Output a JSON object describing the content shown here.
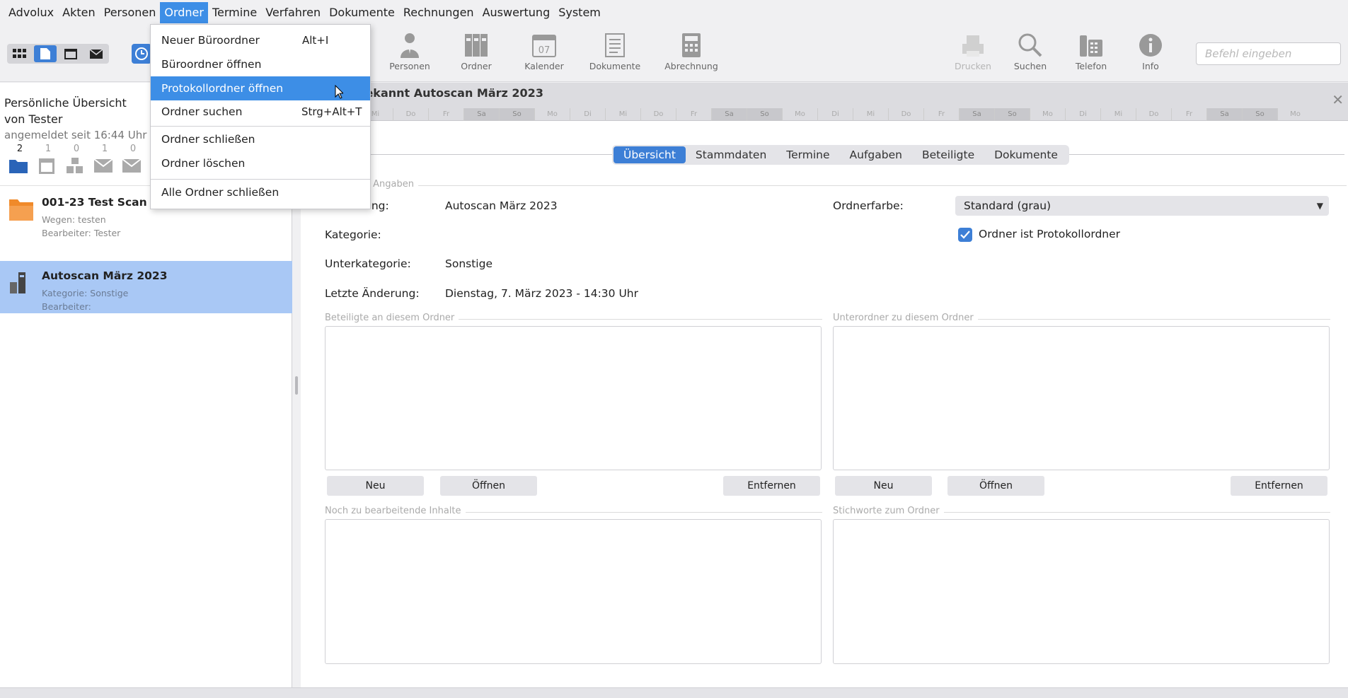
{
  "menubar": {
    "items": [
      "Advolux",
      "Akten",
      "Personen",
      "Ordner",
      "Termine",
      "Verfahren",
      "Dokumente",
      "Rechnungen",
      "Auswertung",
      "System"
    ]
  },
  "ordner_menu": {
    "items": [
      {
        "label": "Neuer Büroordner",
        "shortcut": "Alt+I"
      },
      {
        "label": "Büroordner öffnen",
        "shortcut": ""
      },
      {
        "label": "Protokollordner öffnen",
        "shortcut": ""
      },
      {
        "label": "Ordner suchen",
        "shortcut": "Strg+Alt+T"
      },
      {
        "label": "Ordner schließen",
        "shortcut": ""
      },
      {
        "label": "Ordner löschen",
        "shortcut": ""
      },
      {
        "label": "Alle Ordner schließen",
        "shortcut": ""
      }
    ]
  },
  "toolbar": {
    "personen": "Personen",
    "ordner": "Ordner",
    "kalender": "Kalender",
    "kalender_day": "07",
    "dokumente": "Dokumente",
    "abrechnung": "Abrechnung",
    "drucken": "Drucken",
    "suchen": "Suchen",
    "telefon": "Telefon",
    "info": "Info",
    "command_placeholder": "Befehl eingeben"
  },
  "left": {
    "title": "Persönliche Übersicht von Tester",
    "subtitle": "angemeldet seit 16:44 Uhr",
    "counts": [
      "2",
      "1",
      "0",
      "1",
      "0"
    ],
    "folders": [
      {
        "title": "001-23 Test Scan",
        "line1": "Wegen: testen",
        "line2": "Bearbeiter: Tester"
      },
      {
        "title": "Autoscan März 2023",
        "line1": "Kategorie: Sonstige",
        "line2": "Bearbeiter:"
      }
    ]
  },
  "right": {
    "title": "bekannt Autoscan März 2023",
    "timeline": [
      "Mi",
      "Do",
      "Fr",
      "Sa",
      "So",
      "Mo",
      "Di",
      "Mi",
      "Do",
      "Fr",
      "Sa",
      "So",
      "Mo",
      "Di",
      "Mi",
      "Do",
      "Fr",
      "Sa",
      "So",
      "Mo",
      "Di",
      "Mi",
      "Do",
      "Fr",
      "Sa",
      "So",
      "Mo"
    ],
    "tabs": [
      "Übersicht",
      "Stammdaten",
      "Termine",
      "Aufgaben",
      "Beteiligte",
      "Dokumente"
    ],
    "section_general": "e Angaben",
    "fields": {
      "bezeichnung_label": "ung:",
      "bezeichnung_value": "Autoscan März 2023",
      "kategorie_label": "Kategorie:",
      "kategorie_value": "",
      "unterkategorie_label": "Unterkategorie:",
      "unterkategorie_value": "Sonstige",
      "letzte_label": "Letzte Änderung:",
      "letzte_value": "Dienstag, 7. März 2023 - 14:30 Uhr",
      "ordnerfarbe_label": "Ordnerfarbe:",
      "ordnerfarbe_value": "Standard (grau)",
      "protokoll_label": "Ordner ist Protokollordner"
    },
    "sections": {
      "beteiligte": "Beteiligte an diesem Ordner",
      "unterordner": "Unterordner zu diesem Ordner",
      "inhalte": "Noch zu bearbeitende Inhalte",
      "stichworte": "Stichworte zum Ordner"
    },
    "buttons": {
      "neu": "Neu",
      "oeffnen": "Öffnen",
      "entfernen": "Entfernen"
    }
  }
}
